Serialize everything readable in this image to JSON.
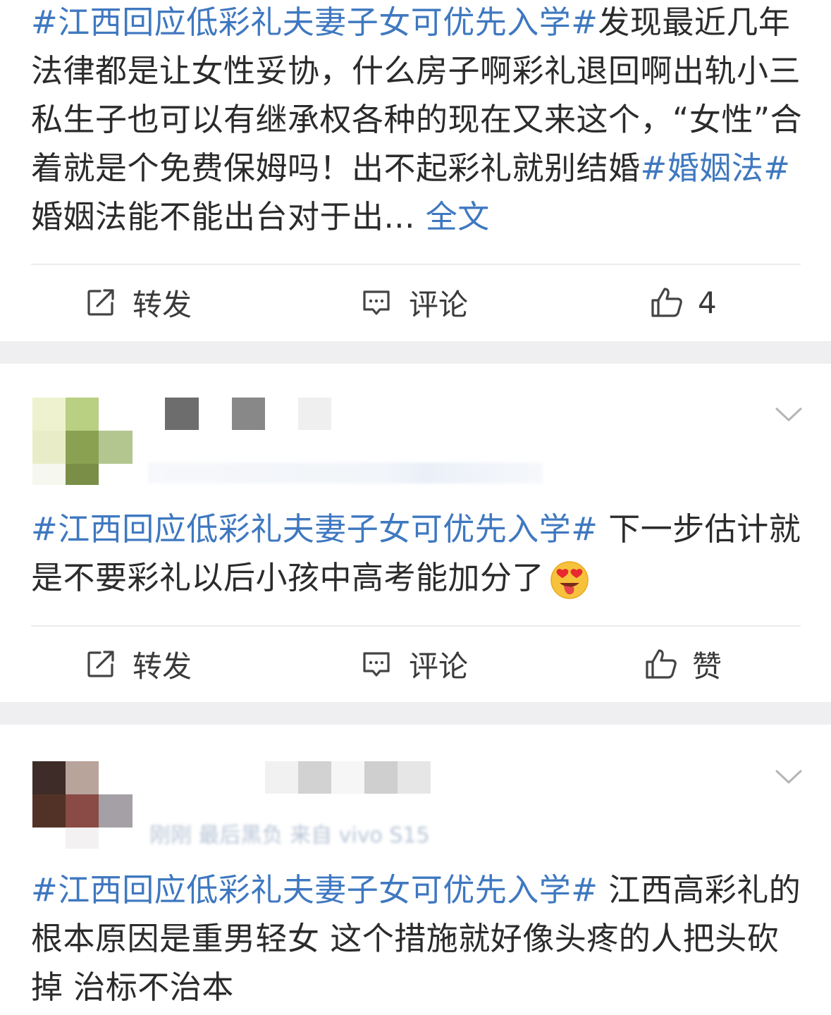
{
  "posts": [
    {
      "text_parts": [
        {
          "text": "#江西回应低彩礼夫妻子女可优先入学#",
          "tag": true
        },
        {
          "text": "发现最近几年法律都是让女性妥协，什么房子啊彩礼退回啊出轨小三私生子也可以有继承权各种的现在又来这个，“女性”合着就是个免费保姆吗！出不起彩礼就别结婚",
          "tag": false
        },
        {
          "text": "#婚姻法#",
          "tag": true
        },
        {
          "text": " 婚姻法能不能出台对于出...",
          "tag": false
        }
      ],
      "more_label": "全文",
      "actions": {
        "repost": "转发",
        "comment": "评论",
        "like": "4"
      }
    },
    {
      "text_parts": [
        {
          "text": "#江西回应低彩礼夫妻子女可优先入学#",
          "tag": true
        },
        {
          "text": " 下一步估计就是不要彩礼以后小孩中高考能加分了",
          "tag": false
        }
      ],
      "emoji": "heart-eyes-tongue-emoji",
      "actions": {
        "repost": "转发",
        "comment": "评论",
        "like": "赞"
      }
    },
    {
      "meta": "刚刚 最后黑负 来自 vivo S15",
      "text_parts": [
        {
          "text": "#江西回应低彩礼夫妻子女可优先入学#",
          "tag": true
        },
        {
          "text": " 江西高彩礼的根本原因是重男轻女 这个措施就好像头疼的人把头砍掉 治标不治本",
          "tag": false
        }
      ]
    }
  ],
  "colors": {
    "accent": "#3f78c0",
    "separator": "#efeff1"
  }
}
